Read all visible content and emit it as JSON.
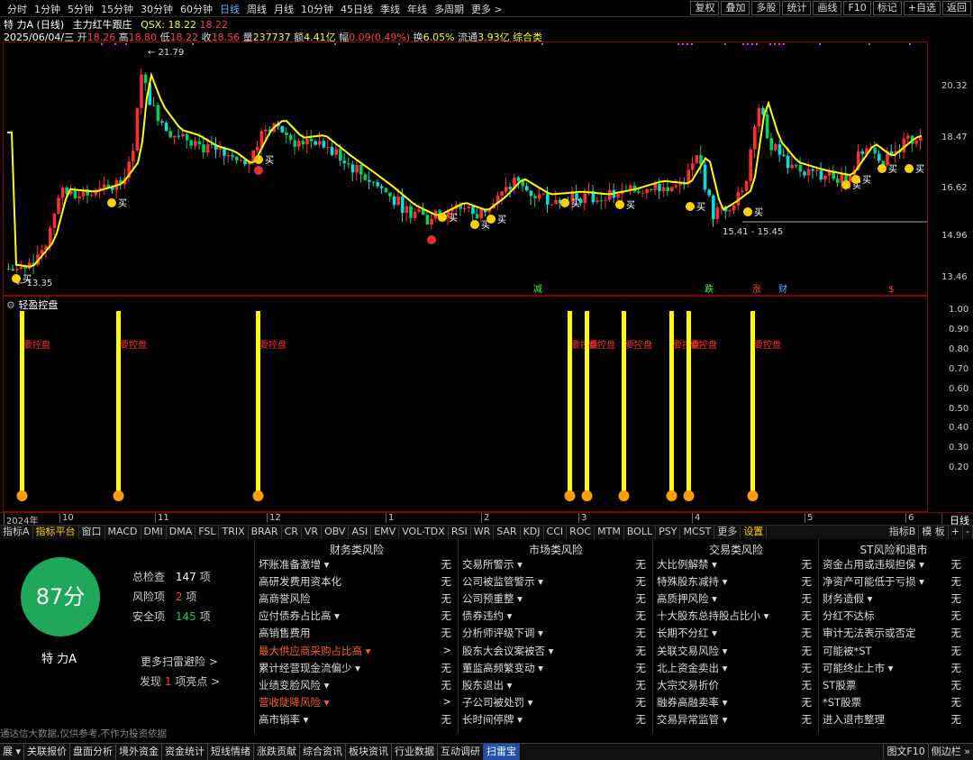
{
  "toolbar": {
    "periods": [
      "分时",
      "1分钟",
      "5分钟",
      "15分钟",
      "30分钟",
      "60分钟",
      "日线",
      "周线",
      "月线",
      "10分钟",
      "45日线",
      "季线",
      "年线",
      "多周期",
      "更多 >"
    ],
    "active_period": "日线",
    "right_buttons": [
      "复权",
      "叠加",
      "多股",
      "统计",
      "画线",
      "F10",
      "标记",
      "+自选",
      "返回"
    ]
  },
  "stock": {
    "name": "特 力A",
    "period_label": "(日线)",
    "indicator": "主力红牛跟庄",
    "qsx": "QSX: 18.22",
    "qsx2": "18.22"
  },
  "quote": {
    "date": "2025/06/04/三",
    "open_label": "开",
    "open": "18.26",
    "high_label": "高",
    "high": "18.80",
    "low_label": "低",
    "low": "18.22",
    "close_label": "收",
    "close": "18.56",
    "vol_label": "量",
    "vol": "237737",
    "amt_label": "额",
    "amt": "4.41亿",
    "chg_label": "幅",
    "chg": "0.09(0.49%)",
    "turn_label": "换",
    "turn": "6.05%",
    "float_label": "流通",
    "float": "3.93亿",
    "category": "综合类"
  },
  "main_chart": {
    "price_ticks": [
      "20.32",
      "18.47",
      "16.62",
      "14.96",
      "13.46"
    ],
    "high_mark": "21.79",
    "low_mark": "13.35",
    "range_label": "15.41 - 15.45",
    "buy_label": "买",
    "event_labels": [
      "减",
      "跌",
      "涨",
      "财",
      "$"
    ]
  },
  "sub_chart": {
    "title": "轻盈控盘",
    "ticks": [
      "1.00",
      "0.90",
      "0.80",
      "0.70",
      "0.60",
      "0.50",
      "0.40",
      "0.30",
      "0.20"
    ],
    "signal_label": "要控盘"
  },
  "date_axis": {
    "labels": [
      "2024年",
      "10",
      "11",
      "12",
      "1",
      "2",
      "3",
      "4",
      "5",
      "6"
    ],
    "right_label": "日线"
  },
  "indicator_tabs": [
    "指标A",
    "指标平台",
    "窗口",
    "MACD",
    "DMI",
    "DMA",
    "FSL",
    "TRIX",
    "BRAR",
    "CR",
    "VR",
    "OBV",
    "ASI",
    "EMV",
    "VOL-TDX",
    "RSI",
    "WR",
    "SAR",
    "KDJ",
    "CCI",
    "ROC",
    "MTM",
    "BOLL",
    "PSY",
    "MCST",
    "更多",
    "设置"
  ],
  "indicator_tabs_right": [
    "指标B",
    "模 板",
    "+",
    "-"
  ],
  "risk": {
    "score": "87分",
    "name": "特 力A",
    "total_label": "总检查",
    "total": "147",
    "total_unit": "项",
    "risk_label": "风险项",
    "risk_count": "2",
    "risk_unit": "项",
    "safe_label": "安全项",
    "safe_count": "145",
    "safe_unit": "项",
    "more_link": "更多扫雷避险 >",
    "find_prefix": "发现",
    "find_count": "1",
    "find_suffix": "项亮点 >",
    "disclaimer": "通达信大数据,仅供参考,不作为投资依据",
    "columns": [
      {
        "title": "财务类风险",
        "items": [
          {
            "label": "坏账准备激增 ▾",
            "value": "无",
            "alert": false
          },
          {
            "label": "高研发费用资本化",
            "value": "无",
            "alert": false
          },
          {
            "label": "高商誉风险",
            "value": "无",
            "alert": false
          },
          {
            "label": "应付债券占比高 ▾",
            "value": "无",
            "alert": false
          },
          {
            "label": "高销售费用",
            "value": "无",
            "alert": false
          },
          {
            "label": "最大供应商采购占比高 ▾",
            "value": ">",
            "alert": true
          },
          {
            "label": "累计经营现金流偏少 ▾",
            "value": "无",
            "alert": false
          },
          {
            "label": "业绩变脸风险 ▾",
            "value": "无",
            "alert": false
          },
          {
            "label": "营收陡降风险 ▾",
            "value": ">",
            "alert": true
          },
          {
            "label": "高市销率 ▾",
            "value": "无",
            "alert": false
          }
        ]
      },
      {
        "title": "市场类风险",
        "items": [
          {
            "label": "交易所警示 ▾",
            "value": "无",
            "alert": false
          },
          {
            "label": "公司被监管警示 ▾",
            "value": "无",
            "alert": false
          },
          {
            "label": "公司预重整 ▾",
            "value": "无",
            "alert": false
          },
          {
            "label": "债券违约 ▾",
            "value": "无",
            "alert": false
          },
          {
            "label": "分析师评级下调 ▾",
            "value": "无",
            "alert": false
          },
          {
            "label": "股东大会议案被否 ▾",
            "value": "无",
            "alert": false
          },
          {
            "label": "董监高频繁变动 ▾",
            "value": "无",
            "alert": false
          },
          {
            "label": "股东退出 ▾",
            "value": "无",
            "alert": false
          },
          {
            "label": "子公司被处罚 ▾",
            "value": "无",
            "alert": false
          },
          {
            "label": "长时间停牌 ▾",
            "value": "无",
            "alert": false
          }
        ]
      },
      {
        "title": "交易类风险",
        "items": [
          {
            "label": "大比例解禁 ▾",
            "value": "无",
            "alert": false
          },
          {
            "label": "特殊股东减持 ▾",
            "value": "无",
            "alert": false
          },
          {
            "label": "高质押风险 ▾",
            "value": "无",
            "alert": false
          },
          {
            "label": "十大股东总持股占比小 ▾",
            "value": "无",
            "alert": false
          },
          {
            "label": "长期不分红 ▾",
            "value": "无",
            "alert": false
          },
          {
            "label": "关联交易风险 ▾",
            "value": "无",
            "alert": false
          },
          {
            "label": "北上资金卖出 ▾",
            "value": "无",
            "alert": false
          },
          {
            "label": "大宗交易折价",
            "value": "无",
            "alert": false
          },
          {
            "label": "融券高融卖率 ▾",
            "value": "无",
            "alert": false
          },
          {
            "label": "交易异常监管 ▾",
            "value": "无",
            "alert": false
          }
        ]
      },
      {
        "title": "ST风险和退市",
        "items": [
          {
            "label": "资金占用或违规担保 ▾",
            "value": "无",
            "alert": false
          },
          {
            "label": "净资产可能低于亏损 ▾",
            "value": "无",
            "alert": false
          },
          {
            "label": "财务造假 ▾",
            "value": "无",
            "alert": false
          },
          {
            "label": "分红不达标",
            "value": "无",
            "alert": false
          },
          {
            "label": "审计无法表示或否定",
            "value": "无",
            "alert": false
          },
          {
            "label": "可能被*ST",
            "value": "无",
            "alert": false
          },
          {
            "label": "可能终止上市 ▾",
            "value": "无",
            "alert": false
          },
          {
            "label": "ST股票",
            "value": "无",
            "alert": false
          },
          {
            "label": "*ST股票",
            "value": "无",
            "alert": false
          },
          {
            "label": "进入退市整理",
            "value": "无",
            "alert": false
          }
        ]
      }
    ]
  },
  "bottom_tabs": [
    "展 ▾",
    "关联报价",
    "盘面分析",
    "境外资金",
    "资金统计",
    "短线情绪",
    "涨跌贡献",
    "综合资讯",
    "板块资讯",
    "行业数据",
    "互动调研",
    "扫雷宝"
  ],
  "bottom_right": [
    "图文F10",
    "侧边栏 »"
  ],
  "colors": {
    "up": "#ff2e2e",
    "down": "#00e0e0",
    "ma": "#ffff00",
    "green": "#00d060",
    "score_bg": "#1fa85a"
  }
}
